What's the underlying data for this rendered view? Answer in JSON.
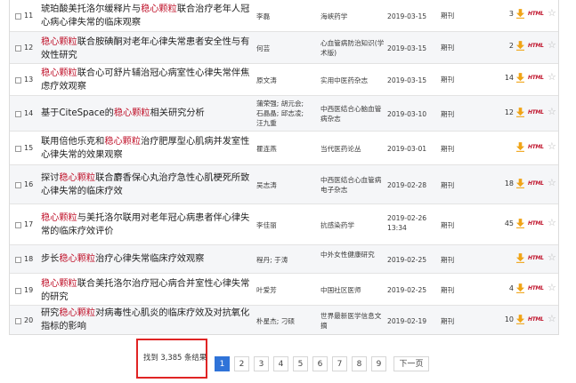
{
  "results": [
    {
      "num": "11",
      "title_parts": [
        {
          "t": "琥珀酸美托洛尔缓释片与"
        },
        {
          "t": "稳心颗粒",
          "kw": true
        },
        {
          "t": "联合治疗老年人冠心病心律失常的临床观察"
        }
      ],
      "author": "李磊",
      "source": "海峡药学",
      "date": "2019-03-15",
      "db": "期刊",
      "count": "3",
      "html": "HTML"
    },
    {
      "num": "12",
      "title_parts": [
        {
          "t": "稳心颗粒",
          "kw": true
        },
        {
          "t": "联合胺碘酮对老年心律失常患者安全性与有效性研究"
        }
      ],
      "author": "何芸",
      "source": "心血管病防治知识(学术版)",
      "date": "2019-03-15",
      "db": "期刊",
      "count": "2",
      "html": "HTML"
    },
    {
      "num": "13",
      "title_parts": [
        {
          "t": "稳心颗粒",
          "kw": true
        },
        {
          "t": "联合心可舒片辅治冠心病室性心律失常伴焦虑疗效观察"
        }
      ],
      "author": "原文涛",
      "source": "实用中医药杂志",
      "date": "2019-03-15",
      "db": "期刊",
      "count": "14",
      "html": "HTML"
    },
    {
      "num": "14",
      "title_parts": [
        {
          "t": "基于CiteSpace的"
        },
        {
          "t": "稳心颗粒",
          "kw": true
        },
        {
          "t": "相关研究分析"
        }
      ],
      "author": "蒲荣强; 胡元会; 石晶晶; 邱志凌; 汪九重",
      "source": "中西医结合心脑血管病杂志",
      "date": "2019-03-10",
      "db": "期刊",
      "count": "12",
      "html": "HTML"
    },
    {
      "num": "15",
      "title_parts": [
        {
          "t": "联用倍他乐克和"
        },
        {
          "t": "稳心颗粒",
          "kw": true
        },
        {
          "t": "治疗肥厚型心肌病并发室性心律失常的效果观察"
        }
      ],
      "author": "瞿连燕",
      "source": "当代医药论丛",
      "date": "2019-03-01",
      "db": "期刊",
      "count": "",
      "html": "HTML"
    },
    {
      "num": "16",
      "title_parts": [
        {
          "t": "探讨"
        },
        {
          "t": "稳心颗粒",
          "kw": true
        },
        {
          "t": "联合麝香保心丸治疗急性心肌梗死所致心律失常的临床疗效"
        }
      ],
      "author": "吴志涛",
      "source": "中西医结合心血管病电子杂志",
      "date": "2019-02-28",
      "db": "期刊",
      "count": "18",
      "html": "HTML"
    },
    {
      "num": "17",
      "title_parts": [
        {
          "t": "稳心颗粒",
          "kw": true
        },
        {
          "t": "与美托洛尔联用对老年冠心病患者伴心律失常的临床疗效评价"
        }
      ],
      "author": "李佳丽",
      "source": "抗感染药学",
      "date": "2019-02-26 13:34",
      "db": "期刊",
      "count": "45",
      "html": "HTML"
    },
    {
      "num": "18",
      "title_parts": [
        {
          "t": "步长"
        },
        {
          "t": "稳心颗粒",
          "kw": true
        },
        {
          "t": "治疗心律失常临床疗效观察"
        }
      ],
      "author": "程丹; 于涛",
      "source": "中外女性健康研究",
      "date": "2019-02-25",
      "db": "期刊",
      "count": "",
      "html": "HTML"
    },
    {
      "num": "19",
      "title_parts": [
        {
          "t": "稳心颗粒",
          "kw": true
        },
        {
          "t": "联合美托洛尔治疗冠心病合并室性心律失常的研究"
        }
      ],
      "author": "叶爱芳",
      "source": "中国社区医师",
      "date": "2019-02-25",
      "db": "期刊",
      "count": "4",
      "html": "HTML"
    },
    {
      "num": "20",
      "title_parts": [
        {
          "t": "研究"
        },
        {
          "t": "稳心颗粒",
          "kw": true
        },
        {
          "t": "对病毒性心肌炎的临床疗效及对抗氧化指标的影响"
        }
      ],
      "author": "朴星杰; 刁硕",
      "source": "世界最新医学信息文摘",
      "date": "2019-02-19",
      "db": "期刊",
      "count": "10",
      "html": "HTML"
    }
  ],
  "footer": {
    "result_text": "找到 3,385 条结果",
    "pages": [
      "1",
      "2",
      "3",
      "4",
      "5",
      "6",
      "7",
      "8",
      "9"
    ],
    "active_page": "1",
    "next_label": "下一页"
  },
  "colors": {
    "keyword": "#c0142c",
    "active_page": "#2f73d8",
    "highlight_box": "#e02424",
    "download_icon": "#f0a416"
  },
  "icons": {
    "download": "download-icon",
    "favorite": "star-icon"
  }
}
